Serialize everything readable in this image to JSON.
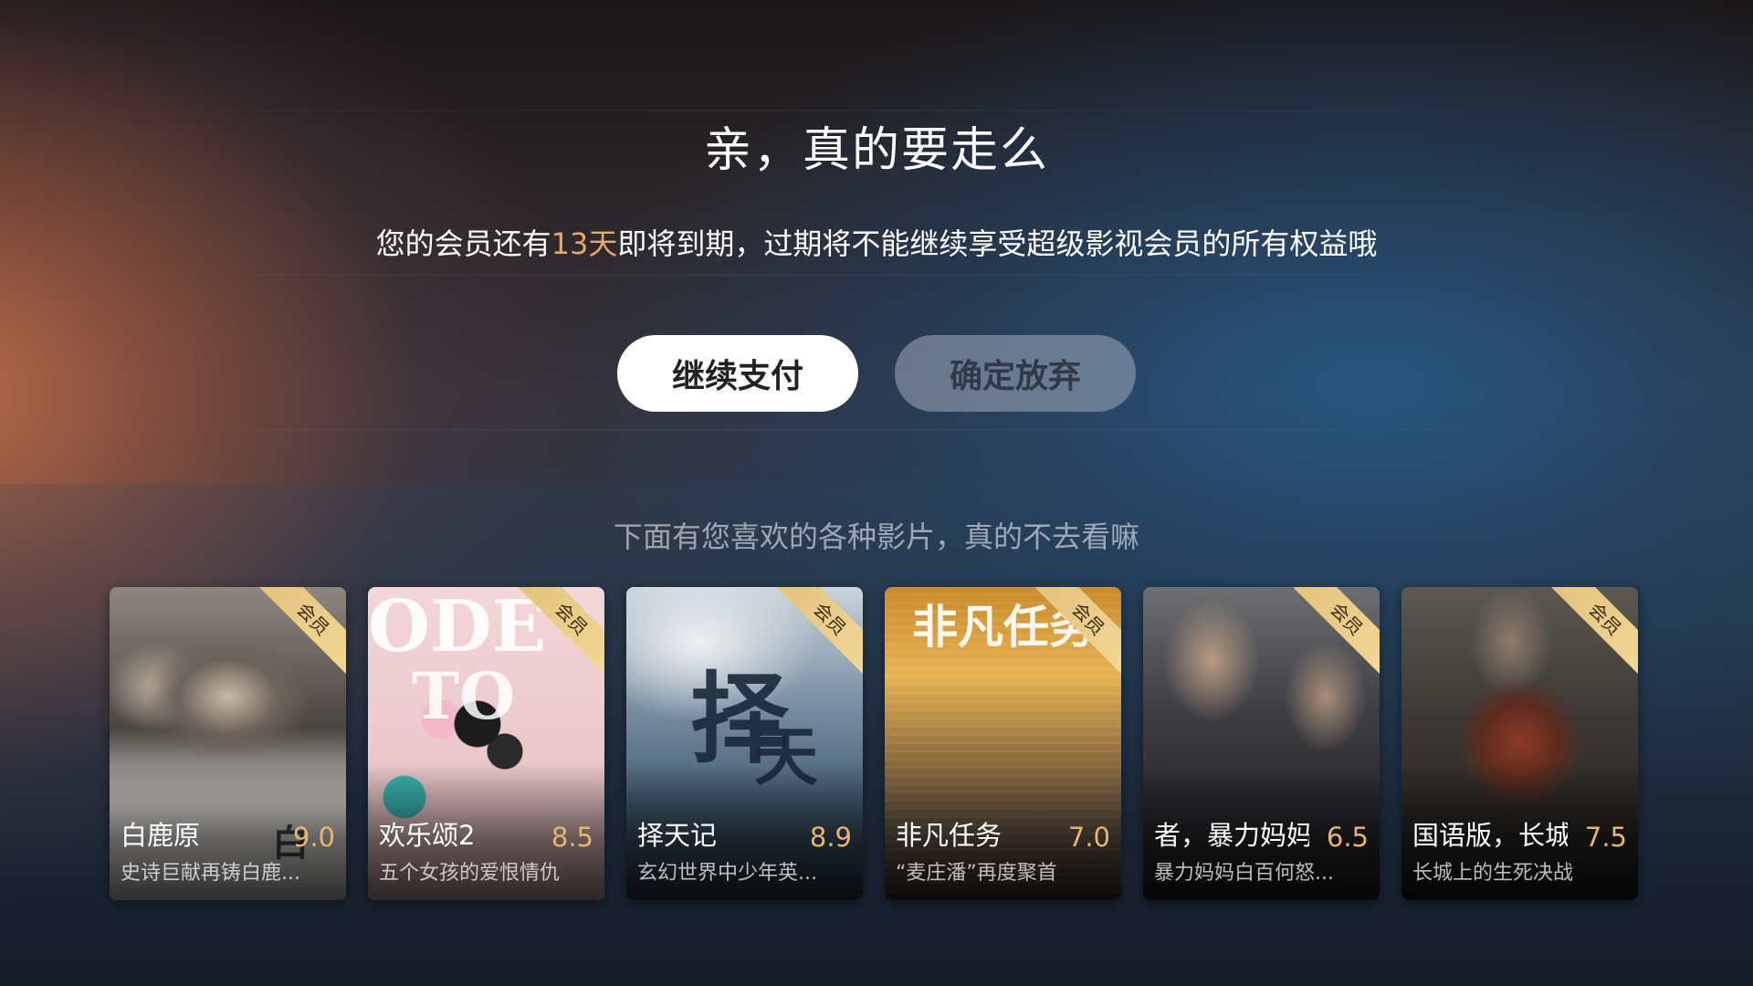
{
  "header": {
    "title": "亲，真的要走么",
    "subtitle_before": "您的会员还有",
    "subtitle_days": "13天",
    "subtitle_after": "即将到期，过期将不能继续享受超级影视会员的所有权益哦"
  },
  "actions": {
    "continue_label": "继续支付",
    "abandon_label": "确定放弃"
  },
  "recommend": {
    "heading": "下面有您喜欢的各种影片，真的不去看嘛",
    "badge_label": "会员",
    "items": [
      {
        "name": "白鹿原",
        "score": "9.0",
        "desc": "史诗巨献再铸白鹿..."
      },
      {
        "name": "欢乐颂2",
        "score": "8.5",
        "desc": "五个女孩的爱恨情仇"
      },
      {
        "name": "择天记",
        "score": "8.9",
        "desc": "玄幻世界中少年英..."
      },
      {
        "name": "非凡任务",
        "score": "7.0",
        "desc": "“麦庄潘”再度聚首"
      },
      {
        "name": "者，暴力妈妈",
        "score": "6.5",
        "desc": "暴力妈妈白百何怒..."
      },
      {
        "name": "国语版，长城",
        "score": "7.5",
        "desc": "长城上的生死决战"
      }
    ]
  },
  "colors": {
    "highlight": "#e7a967",
    "score": "#e9b56e",
    "badge": "#e3c27c"
  }
}
